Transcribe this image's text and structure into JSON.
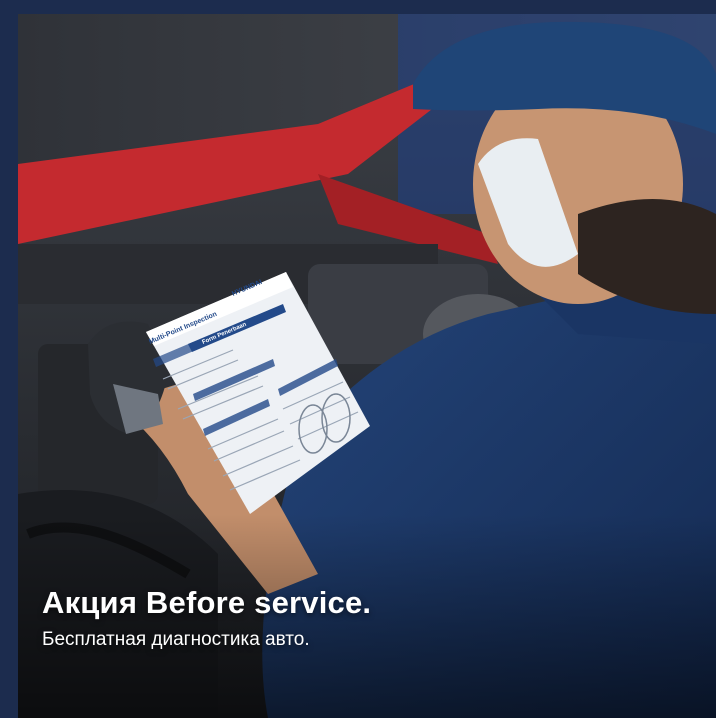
{
  "promo": {
    "headline": "Акция Before service.",
    "subline": "Бесплатная диагностика авто."
  },
  "inspection_form": {
    "brand": "HYUNDAI",
    "title": "Multi-Point Inspection",
    "tab": "Form Penerbaan"
  },
  "colors": {
    "frame_background": "#1c2c4e",
    "uniform_navy": "#1f3a68",
    "car_red": "#c42a2f",
    "caption_text": "#ffffff"
  }
}
